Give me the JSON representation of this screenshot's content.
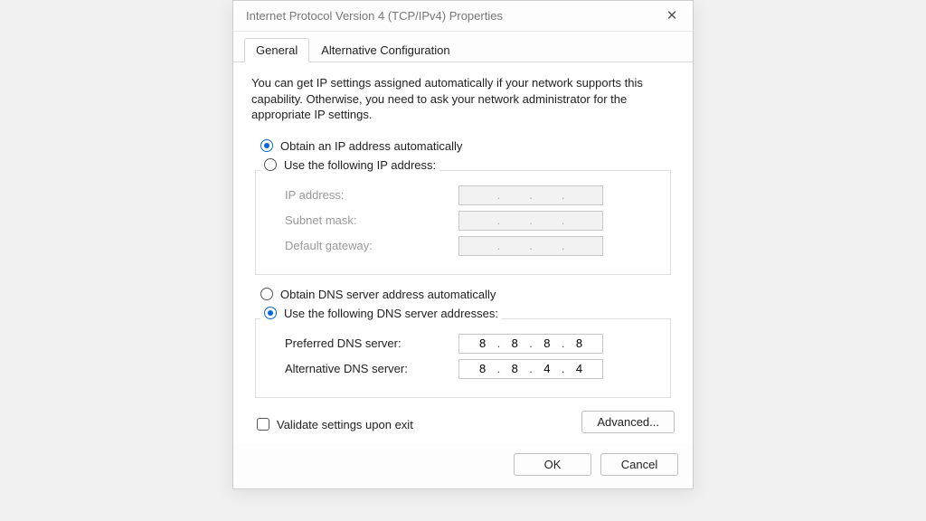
{
  "window": {
    "title": "Internet Protocol Version 4 (TCP/IPv4) Properties"
  },
  "tabs": {
    "general": "General",
    "alt": "Alternative Configuration"
  },
  "intro": "You can get IP settings assigned automatically if your network supports this capability. Otherwise, you need to ask your network administrator for the appropriate IP settings.",
  "ip": {
    "auto_label": "Obtain an IP address automatically",
    "manual_label": "Use the following IP address:",
    "addr_label": "IP address:",
    "mask_label": "Subnet mask:",
    "gw_label": "Default gateway:",
    "addr": [
      "",
      "",
      "",
      ""
    ],
    "mask": [
      "",
      "",
      "",
      ""
    ],
    "gw": [
      "",
      "",
      "",
      ""
    ]
  },
  "dns": {
    "auto_label": "Obtain DNS server address automatically",
    "manual_label": "Use the following DNS server addresses:",
    "pref_label": "Preferred DNS server:",
    "alt_label": "Alternative DNS server:",
    "pref": [
      "8",
      "8",
      "8",
      "8"
    ],
    "alt": [
      "8",
      "8",
      "4",
      "4"
    ]
  },
  "validate_label": "Validate settings upon exit",
  "buttons": {
    "advanced": "Advanced...",
    "ok": "OK",
    "cancel": "Cancel"
  }
}
